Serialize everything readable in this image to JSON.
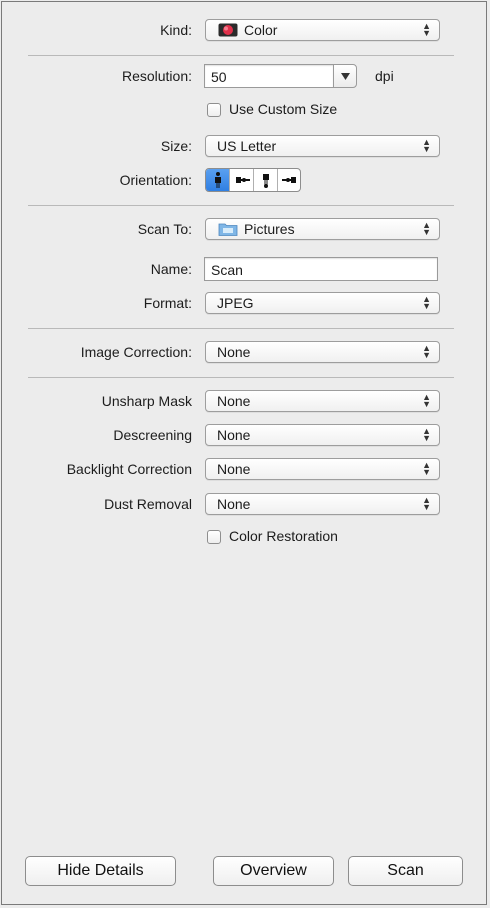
{
  "kind": {
    "label": "Kind:",
    "value": "Color",
    "icon": "color-mode-icon"
  },
  "resolution": {
    "label": "Resolution:",
    "value": "50",
    "unit": "dpi",
    "dropdown_icon": "triangle-down-icon"
  },
  "custom_size": {
    "label": "Use Custom Size",
    "checked": false
  },
  "size": {
    "label": "Size:",
    "value": "US Letter"
  },
  "orientation": {
    "label": "Orientation:",
    "options": [
      "portrait-upright-icon",
      "rotate-left-icon",
      "portrait-inverted-icon",
      "rotate-right-icon"
    ],
    "selected_index": 0
  },
  "scan_to": {
    "label": "Scan To:",
    "value": "Pictures",
    "icon": "folder-icon"
  },
  "name": {
    "label": "Name:",
    "value": "Scan"
  },
  "format": {
    "label": "Format:",
    "value": "JPEG"
  },
  "image_correction": {
    "label": "Image Correction:",
    "value": "None"
  },
  "unsharp_mask": {
    "label": "Unsharp Mask",
    "value": "None"
  },
  "descreening": {
    "label": "Descreening",
    "value": "None"
  },
  "backlight_correction": {
    "label": "Backlight Correction",
    "value": "None"
  },
  "dust_removal": {
    "label": "Dust Removal",
    "value": "None"
  },
  "color_restoration": {
    "label": "Color Restoration",
    "checked": false
  },
  "buttons": {
    "hide_details": "Hide Details",
    "overview": "Overview",
    "scan": "Scan"
  },
  "colors": {
    "selected_segment": "#2f7fe3",
    "window_bg": "#ececec"
  }
}
